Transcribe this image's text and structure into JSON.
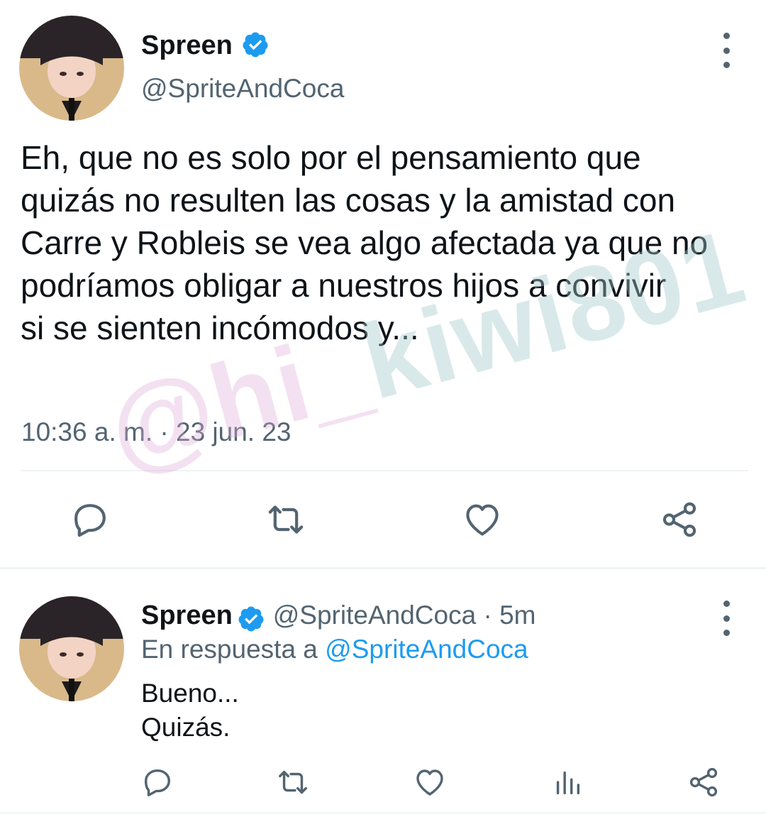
{
  "main_tweet": {
    "author_name": "Spreen",
    "author_handle": "@SpriteAndCoca",
    "text": "Eh, que no es solo por el pensamiento que\nquizás no resulten las cosas y la amistad con\nCarre y Robleis se vea algo afectada ya que no\npodríamos obligar a nuestros hijos a convivir\nsi se sienten incómodos y...",
    "timestamp": "10:36 a. m. · 23 jun. 23",
    "actions": [
      "reply-icon",
      "retweet-icon",
      "like-icon",
      "share-icon"
    ]
  },
  "reply_tweet": {
    "author_name": "Spreen",
    "author_handle": "@SpriteAndCoca",
    "separator": " · ",
    "time_ago": "5m",
    "replying_to_prefix": "En respuesta a ",
    "replying_to_handle": "@SpriteAndCoca",
    "text": "Bueno...\nQuizás.",
    "actions": [
      "reply-icon",
      "retweet-icon",
      "like-icon",
      "analytics-icon",
      "share-icon"
    ]
  },
  "watermark": {
    "part1": "@hi_",
    "part2": "kiwi801"
  },
  "colors": {
    "verified": "#1d9bf0",
    "secondary_text": "#536471",
    "link": "#1d9bf0",
    "divider": "#eff3f4"
  }
}
